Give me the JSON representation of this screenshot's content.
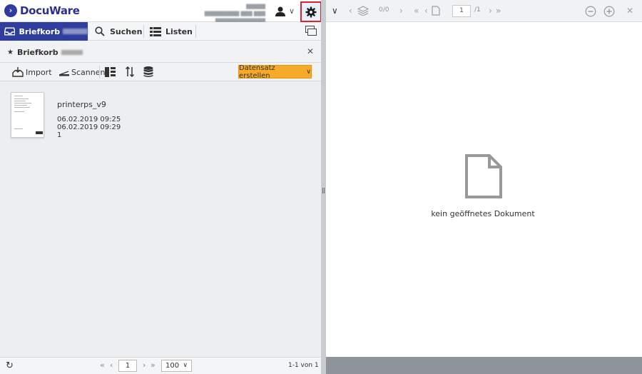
{
  "app": {
    "brand": "DocuWare",
    "user_info_line1": "▇▇▇▇▇",
    "user_info_line2": "▇▇▇▇▇▇▇▇▇ ▇▇▇ ▇▇▇ ▇▇▇▇▇▇▇▇▇▇▇▇▇"
  },
  "tabs": [
    {
      "label": "Briefkorb",
      "active": true
    },
    {
      "label": "Suchen",
      "active": false
    },
    {
      "label": "Listen",
      "active": false
    }
  ],
  "panel": {
    "title": "Briefkorb"
  },
  "toolbar": {
    "import_label": "Import",
    "scan_label": "Scannen",
    "create_label": "Datensatz erstellen"
  },
  "documents": [
    {
      "name": "printerps_v9",
      "field1": "06.02.2019 09:25",
      "field2": "06.02.2019 09:29",
      "field3": "1"
    }
  ],
  "footer": {
    "page": "1",
    "page_size": "100",
    "result_count": "1-1 von 1"
  },
  "viewer": {
    "page_counter": "0/0",
    "page_input": "1",
    "page_total": "/1",
    "empty_message": "kein geöffnetes Dokument"
  },
  "colors": {
    "brand": "#2f3d9e",
    "accent": "#f7a928",
    "highlight": "#e0212f"
  }
}
